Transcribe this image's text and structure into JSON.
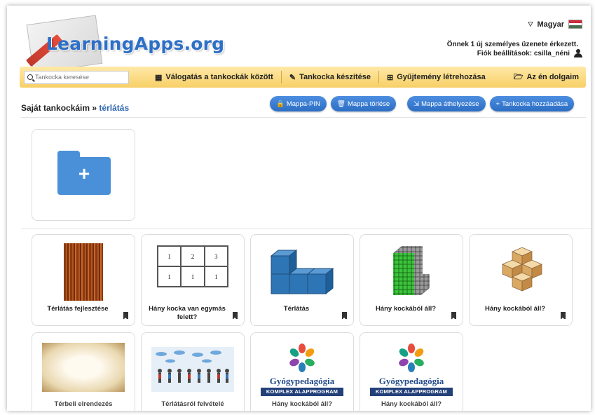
{
  "header": {
    "logo_text": "LearningApps.org",
    "language": "Magyar",
    "message": "Önnek 1 új személyes üzenete érkezett.",
    "account": "Fiók beállítások: csilla_néni"
  },
  "navbar": {
    "search_placeholder": "Tankocka keresése",
    "items": [
      {
        "label": "Válogatás a tankockák között",
        "icon": "grid-icon"
      },
      {
        "label": "Tankocka készítése",
        "icon": "pencil-icon"
      },
      {
        "label": "Gyűjtemény létrehozása",
        "icon": "collection-icon"
      },
      {
        "label": "Az én dolgaim",
        "icon": "folder-open-icon"
      }
    ]
  },
  "breadcrumb": {
    "root": "Saját tankockáim",
    "separator": "»",
    "current": "térlátás"
  },
  "actions": {
    "pin": "Mappa-PIN",
    "delete": "Mappa törlése",
    "move": "Mappa áthelyezése",
    "add": "Tankocka hozzáadása"
  },
  "apps": [
    {
      "title": "Térlátás fejlesztése",
      "thumb": "wood-texture"
    },
    {
      "title": "Hány kocka van egymás felett?",
      "thumb": "number-grid"
    },
    {
      "title": "Térlátás",
      "thumb": "blue-cubes"
    },
    {
      "title": "Hány kockából áll?",
      "thumb": "green-cubes"
    },
    {
      "title": "Hány kockából áll?",
      "thumb": "wooden-cubes"
    }
  ],
  "grid_numbers": [
    "1",
    "2",
    "3",
    "1",
    "1",
    "1"
  ],
  "apps_row2": [
    {
      "title": "Térbeli elrendezés",
      "thumb": "old-paper"
    },
    {
      "title": "Térlátásról felvételé",
      "thumb": "people-walking"
    },
    {
      "title": "Hány kockából áll?",
      "thumb": "gyogypedagogia",
      "logo_title": "Gyógypedagógia",
      "logo_band": "KOMPLEX ALAPPROGRAM"
    },
    {
      "title": "Hány kockából áll?",
      "thumb": "gyogypedagogia",
      "logo_title": "Gyógypedagógia",
      "logo_band": "KOMPLEX ALAPPROGRAM"
    }
  ],
  "colors": {
    "brand": "#2e6fc7",
    "navbar": "#f7cf66",
    "button": "#2c6ec4",
    "folder": "#4a90d9"
  }
}
